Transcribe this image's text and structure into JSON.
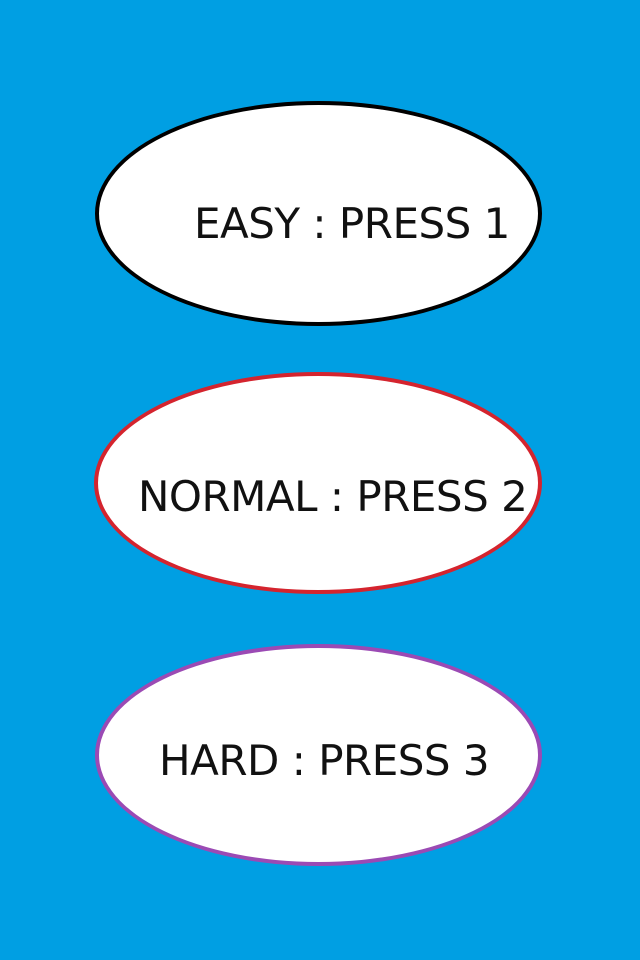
{
  "menu": {
    "options": [
      {
        "label": "EASY : PRESS 1",
        "border_color": "#000000"
      },
      {
        "label": "NORMAL : PRESS 2",
        "border_color": "#d4242e"
      },
      {
        "label": "HARD : PRESS 3",
        "border_color": "#9b4ab4"
      }
    ]
  },
  "colors": {
    "background": "#009fe3",
    "button_fill": "#ffffff",
    "text": "#111111"
  }
}
